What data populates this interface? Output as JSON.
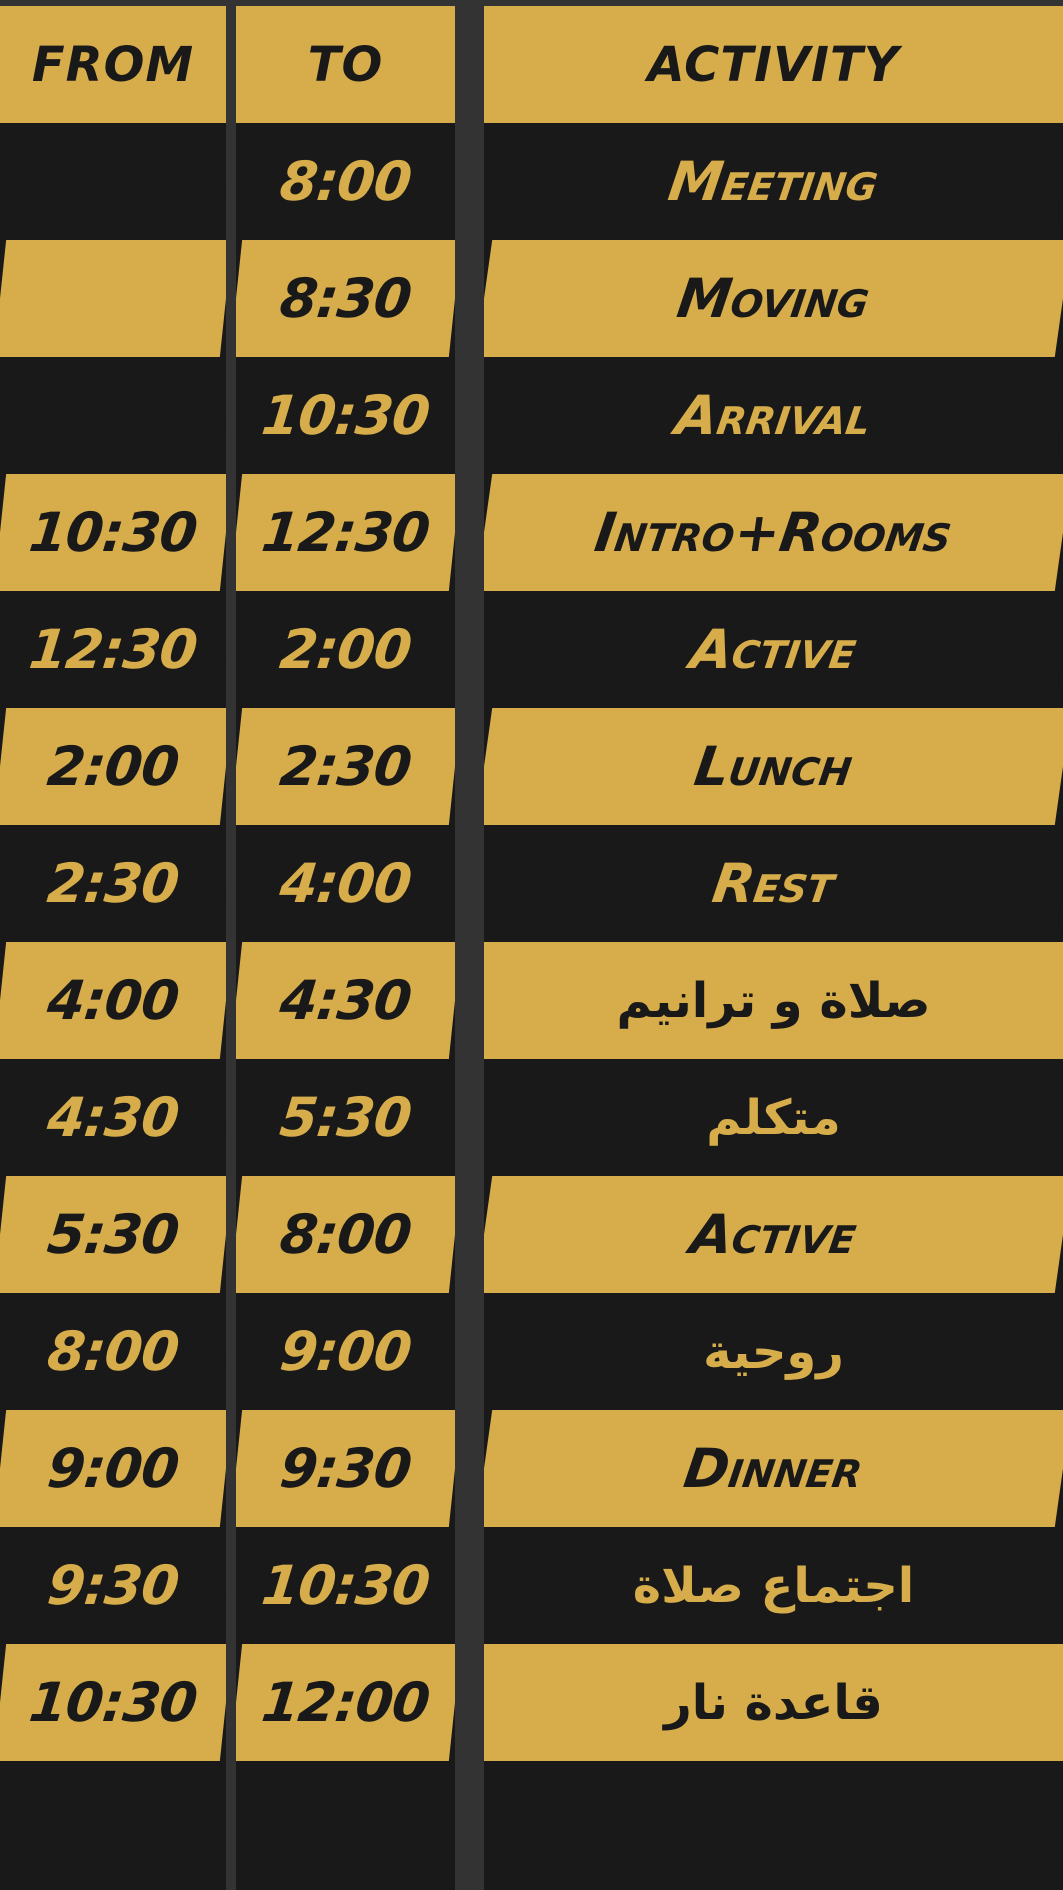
{
  "headers": {
    "from": "FROM",
    "to": "TO",
    "activity": "ACTIVITY"
  },
  "rows": [
    {
      "from": "",
      "to": "8:00",
      "activity": "Meeting"
    },
    {
      "from": "",
      "to": "8:30",
      "activity": "Moving"
    },
    {
      "from": "",
      "to": "10:30",
      "activity": "Arrival"
    },
    {
      "from": "10:30",
      "to": "12:30",
      "activity": "Intro+Rooms"
    },
    {
      "from": "12:30",
      "to": "2:00",
      "activity": "Active"
    },
    {
      "from": "2:00",
      "to": "2:30",
      "activity": "Lunch"
    },
    {
      "from": "2:30",
      "to": "4:00",
      "activity": "Rest"
    },
    {
      "from": "4:00",
      "to": "4:30",
      "activity": "صلاة و ترانيم"
    },
    {
      "from": "4:30",
      "to": "5:30",
      "activity": "متكلم"
    },
    {
      "from": "5:30",
      "to": "8:00",
      "activity": "Active"
    },
    {
      "from": "8:00",
      "to": "9:00",
      "activity": "روحية"
    },
    {
      "from": "9:00",
      "to": "9:30",
      "activity": "Dinner"
    },
    {
      "from": "9:30",
      "to": "10:30",
      "activity": "اجتماع صلاة"
    },
    {
      "from": "10:30",
      "to": "12:00",
      "activity": "قاعدة نار"
    }
  ],
  "colors": {
    "gold": "#d6ad4a",
    "dark": "#191919",
    "separator": "#333333"
  }
}
